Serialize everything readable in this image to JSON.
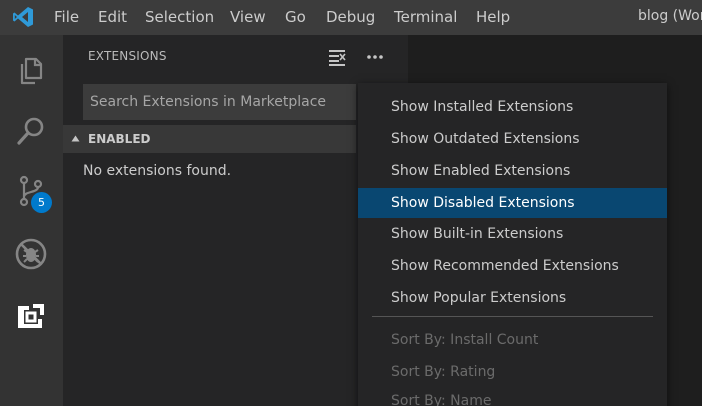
{
  "menubar": {
    "items": [
      "File",
      "Edit",
      "Selection",
      "View",
      "Go",
      "Debug",
      "Terminal",
      "Help"
    ],
    "window_title": "blog (Wor"
  },
  "activitybar": {
    "icons": [
      "files-icon",
      "search-icon",
      "source-control-icon",
      "debug-icon",
      "extensions-icon"
    ],
    "source_control_badge": "5"
  },
  "sidebar": {
    "title": "EXTENSIONS",
    "search_placeholder": "Search Extensions in Marketplace",
    "section_label": "ENABLED",
    "empty_message": "No extensions found."
  },
  "context_menu": {
    "items": [
      {
        "label": "Show Installed Extensions",
        "state": "normal"
      },
      {
        "label": "Show Outdated Extensions",
        "state": "normal"
      },
      {
        "label": "Show Enabled Extensions",
        "state": "normal"
      },
      {
        "label": "Show Disabled Extensions",
        "state": "active"
      },
      {
        "label": "Show Built-in Extensions",
        "state": "normal"
      },
      {
        "label": "Show Recommended Extensions",
        "state": "normal"
      },
      {
        "label": "Show Popular Extensions",
        "state": "normal"
      }
    ],
    "sort_items": [
      {
        "label": "Sort By: Install Count",
        "state": "disabled"
      },
      {
        "label": "Sort By: Rating",
        "state": "disabled"
      },
      {
        "label": "Sort By: Name",
        "state": "disabled"
      }
    ]
  },
  "colors": {
    "accent": "#007acc",
    "selection": "#094771",
    "menubar": "#3c3c3c",
    "activitybar": "#333333",
    "sidebar": "#252526",
    "editor": "#1e1e1e"
  }
}
